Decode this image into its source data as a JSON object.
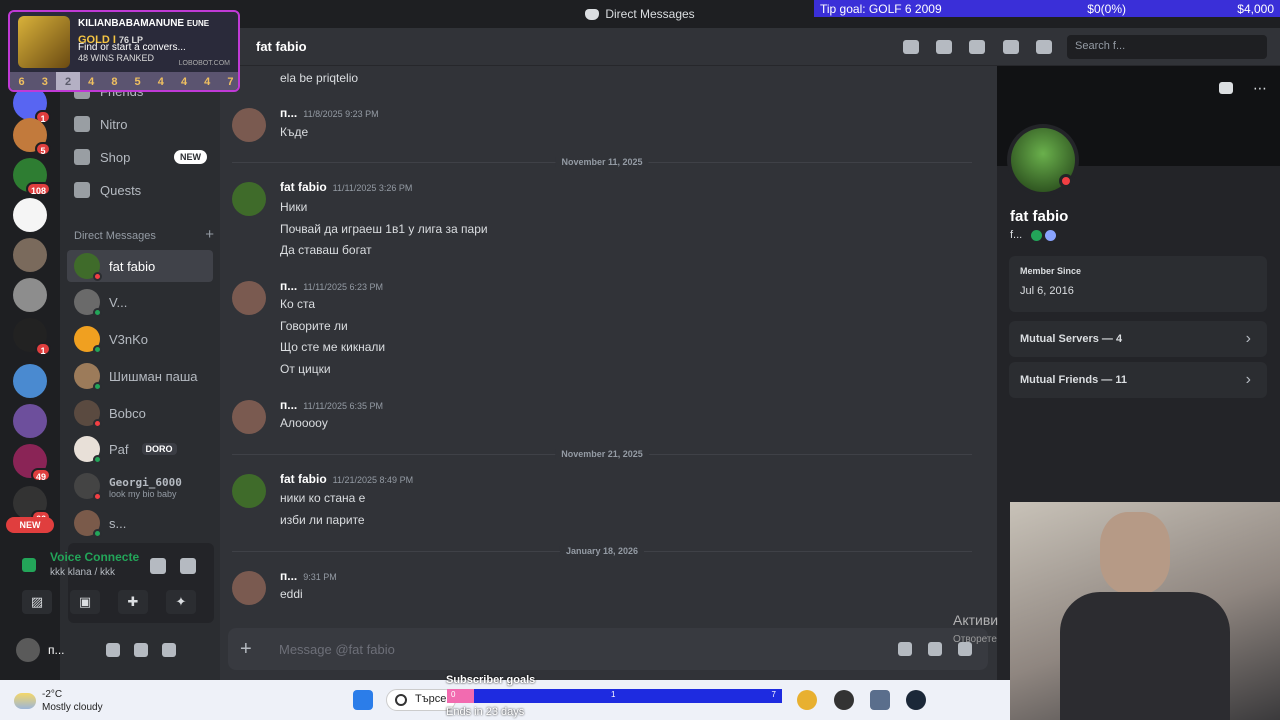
{
  "window": {
    "title": "Direct Messages"
  },
  "tip_goal": {
    "label": "Tip goal: GOLF 6 2009",
    "progress": "$0(0%)",
    "target": "$4,000"
  },
  "overlay": {
    "player": "KILIANBABAMANUNE",
    "region": "EUNE",
    "rank": "GOLD I",
    "lp": "76 LP",
    "wins": "48 WINS RANKED",
    "find_text": "Find or start a convers...",
    "site": "LOBOBOT.COM",
    "streak": [
      "6",
      "3",
      "2",
      "4",
      "8",
      "5",
      "4",
      "4",
      "4",
      "7"
    ]
  },
  "servers": [
    {
      "badge": "1"
    },
    {
      "badge": "5"
    },
    {
      "badge": "108"
    },
    {
      "badge": ""
    },
    {
      "badge": ""
    },
    {
      "badge": ""
    },
    {
      "badge": "1"
    },
    {
      "badge": ""
    },
    {
      "badge": ""
    },
    {
      "badge": "49"
    },
    {
      "badge": "66"
    }
  ],
  "servers_new": "NEW",
  "nav": {
    "friends": "Friends",
    "nitro": "Nitro",
    "shop": "Shop",
    "shop_tag": "NEW",
    "quests": "Quests"
  },
  "dm_header": "Direct Messages",
  "dm_add": "+",
  "dms": [
    {
      "name": "fat fabio",
      "sub": "",
      "status": "#f23f43"
    },
    {
      "name": "V...",
      "sub": "",
      "status": "#23a559"
    },
    {
      "name": "V3nKo",
      "sub": "",
      "status": "#23a559"
    },
    {
      "name": "Шишман паша",
      "sub": "",
      "status": "#23a559"
    },
    {
      "name": "Bobco",
      "sub": "",
      "status": "#f23f43"
    },
    {
      "name": "Paf",
      "sub": "",
      "status": "#23a559",
      "tag": "DORO"
    },
    {
      "name": "Georgi_6000",
      "sub": "look my bio baby",
      "status": "#f23f43"
    },
    {
      "name": "s...",
      "sub": "",
      "status": "#23a559"
    }
  ],
  "voice": {
    "title": "Voice Connecte",
    "channel": "kkk klana / kkk"
  },
  "user": {
    "name": "п..."
  },
  "chat": {
    "recipient": "fat fabio",
    "search_placeholder": "Search f...",
    "composer_placeholder": "Message @fat fabio",
    "dates": [
      "November 11, 2025",
      "November 21, 2025",
      "January 18, 2026"
    ],
    "messages": [
      {
        "author": "",
        "time": "",
        "lines": [
          "ela be priqtelio"
        ]
      },
      {
        "author": "п...",
        "time": "11/8/2025 9:23 PM",
        "lines": [
          "Къде"
        ]
      },
      {
        "author": "fat fabio",
        "time": "11/11/2025 3:26 PM",
        "lines": [
          "Ники",
          "Почвай да играеш 1в1 у лига за пари",
          "Да ставаш богат"
        ]
      },
      {
        "author": "п...",
        "time": "11/11/2025 6:23 PM",
        "lines": [
          "Ко ста",
          "Говорите ли",
          "Що сте ме кикнали",
          "От цицки"
        ]
      },
      {
        "author": "п...",
        "time": "11/11/2025 6:35 PM",
        "lines": [
          "Алоооoy"
        ]
      },
      {
        "author": "fat fabio",
        "time": "11/21/2025 8:49 PM",
        "lines": [
          "ники ко стана е",
          "изби ли парите"
        ]
      },
      {
        "author": "п...",
        "time": "9:31 PM",
        "lines": [
          "eddi"
        ]
      }
    ]
  },
  "profile": {
    "name": "fat fabio",
    "tag": "f...",
    "member_since_label": "Member Since",
    "member_since": "Jul 6, 2016",
    "mutual_servers": "Mutual Servers — 4",
    "mutual_friends": "Mutual Friends — 11"
  },
  "watermark": {
    "line1": "Активи",
    "line2": "Отворете"
  },
  "taskbar": {
    "temp": "-2°C",
    "weather": "Mostly cloudy",
    "search": "Търсене",
    "sub_goal_title": "Subscriber goals",
    "sub_goal_left": "0",
    "sub_goal_mid": "1",
    "sub_goal_right": "7",
    "sub_goal_progress": 0.08,
    "sub_goal_ends": "Ends in 23 days"
  }
}
